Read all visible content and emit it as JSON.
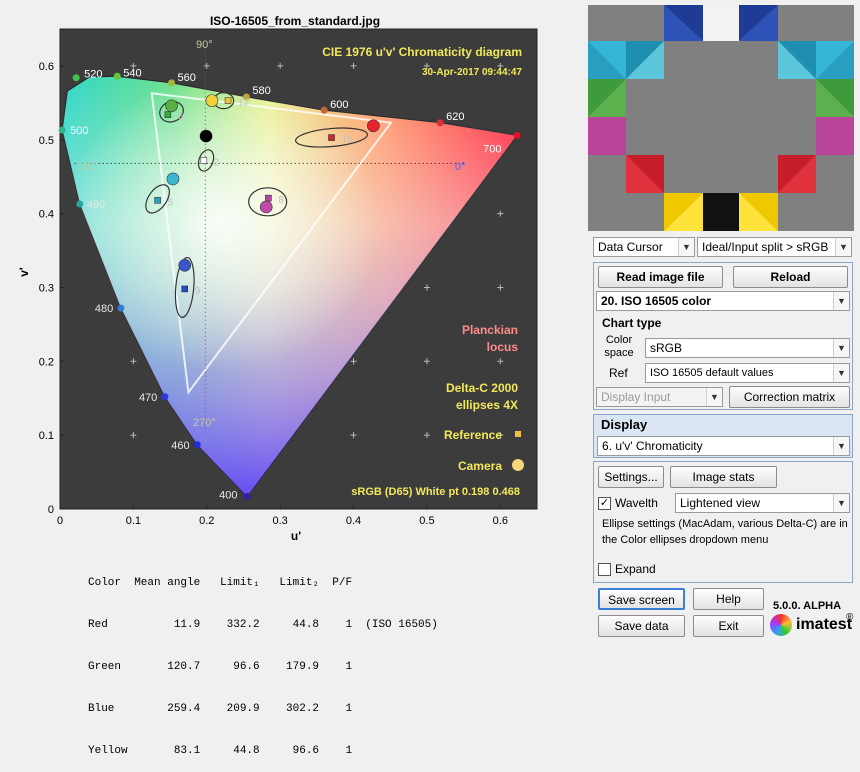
{
  "plot": {
    "title": "ISO-16505_from_standard.jpg",
    "chart_title": "CIE 1976 u'v' Chromaticity diagram",
    "timestamp": "30-Apr-2017 09:44:47",
    "xlabel": "u'",
    "ylabel": "v'",
    "planckian": [
      "Planckian",
      "locus"
    ],
    "delta": [
      "Delta-C 2000",
      "ellipses 4X"
    ],
    "reference": "Reference",
    "camera": "Camera",
    "whitept": "sRGB (D65)  White pt  0.198  0.468",
    "deg90": "90°",
    "deg180": "180°",
    "deg0": "0°",
    "deg270": "270°"
  },
  "chart_data": {
    "type": "scatter",
    "xlim": [
      0,
      0.65
    ],
    "ylim": [
      0,
      0.65
    ],
    "xticks": [
      "0",
      "0.1",
      "0.2",
      "0.3",
      "0.4",
      "0.5",
      "0.6"
    ],
    "yticks": [
      "0",
      "0.1",
      "0.2",
      "0.3",
      "0.4",
      "0.5",
      "0.6"
    ],
    "wavelength_labels": [
      {
        "nm": "400",
        "u": 0.255,
        "v": 0.017
      },
      {
        "nm": "460",
        "u": 0.187,
        "v": 0.087
      },
      {
        "nm": "470",
        "u": 0.143,
        "v": 0.152
      },
      {
        "nm": "480",
        "u": 0.083,
        "v": 0.272
      },
      {
        "nm": "490",
        "u": 0.027,
        "v": 0.413
      },
      {
        "nm": "500",
        "u": 0.003,
        "v": 0.513
      },
      {
        "nm": "520",
        "u": 0.022,
        "v": 0.584
      },
      {
        "nm": "540",
        "u": 0.078,
        "v": 0.586
      },
      {
        "nm": "560",
        "u": 0.152,
        "v": 0.577
      },
      {
        "nm": "580",
        "u": 0.254,
        "v": 0.558
      },
      {
        "nm": "600",
        "u": 0.36,
        "v": 0.54
      },
      {
        "nm": "620",
        "u": 0.518,
        "v": 0.523
      },
      {
        "nm": "700",
        "u": 0.623,
        "v": 0.506
      }
    ],
    "reference_points": [
      {
        "label": "6",
        "u": 0.147,
        "v": 0.534
      },
      {
        "label": "12",
        "u": 0.229,
        "v": 0.553
      },
      {
        "label": "13",
        "u": 0.37,
        "v": 0.503
      },
      {
        "label": "2",
        "u": 0.196,
        "v": 0.472
      },
      {
        "label": "5",
        "u": 0.133,
        "v": 0.418
      },
      {
        "label": "8",
        "u": 0.284,
        "v": 0.421
      },
      {
        "label": "9",
        "u": 0.17,
        "v": 0.298
      }
    ],
    "camera_points": [
      {
        "u": 0.152,
        "v": 0.546
      },
      {
        "u": 0.207,
        "v": 0.553
      },
      {
        "u": 0.427,
        "v": 0.519
      },
      {
        "u": 0.199,
        "v": 0.505
      },
      {
        "u": 0.154,
        "v": 0.447
      },
      {
        "u": 0.281,
        "v": 0.409
      },
      {
        "u": 0.17,
        "v": 0.33
      }
    ]
  },
  "stats": {
    "header": "Color  Mean angle   Limit₁   Limit₂  P/F",
    "rows": [
      "Red          11.9    332.2     44.8    1  (ISO 16505)",
      "Green       120.7     96.6    179.9    1",
      "Blue        259.4    209.9    302.2    1",
      "Yellow       83.1     44.8     96.6    1"
    ]
  },
  "controls": {
    "data_cursor": "Data Cursor",
    "split": "Ideal/Input split > sRGB",
    "read_image": "Read image file",
    "reload": "Reload",
    "chart_select": "20. ISO 16505 color",
    "chart_type": "Chart type",
    "color_space_label": "Color space",
    "color_space": "sRGB",
    "ref_label": "Ref",
    "ref_value": "ISO 16505 default values",
    "display_input": "Display Input",
    "correction": "Correction matrix",
    "display_header": "Display",
    "display_value": "6.  u'v' Chromaticity",
    "settings": "Settings...",
    "image_stats": "Image stats",
    "wavelth": "Wavelth",
    "view": "Lightened view",
    "ellipse_note": "Ellipse settings (MacAdam, various Delta-C) are in the Color ellipses dropdown menu",
    "expand": "Expand",
    "save_screen": "Save screen",
    "help": "Help",
    "save_data": "Save data",
    "exit": "Exit",
    "version": "5.0.0. ALPHA",
    "brand": "imatest"
  }
}
